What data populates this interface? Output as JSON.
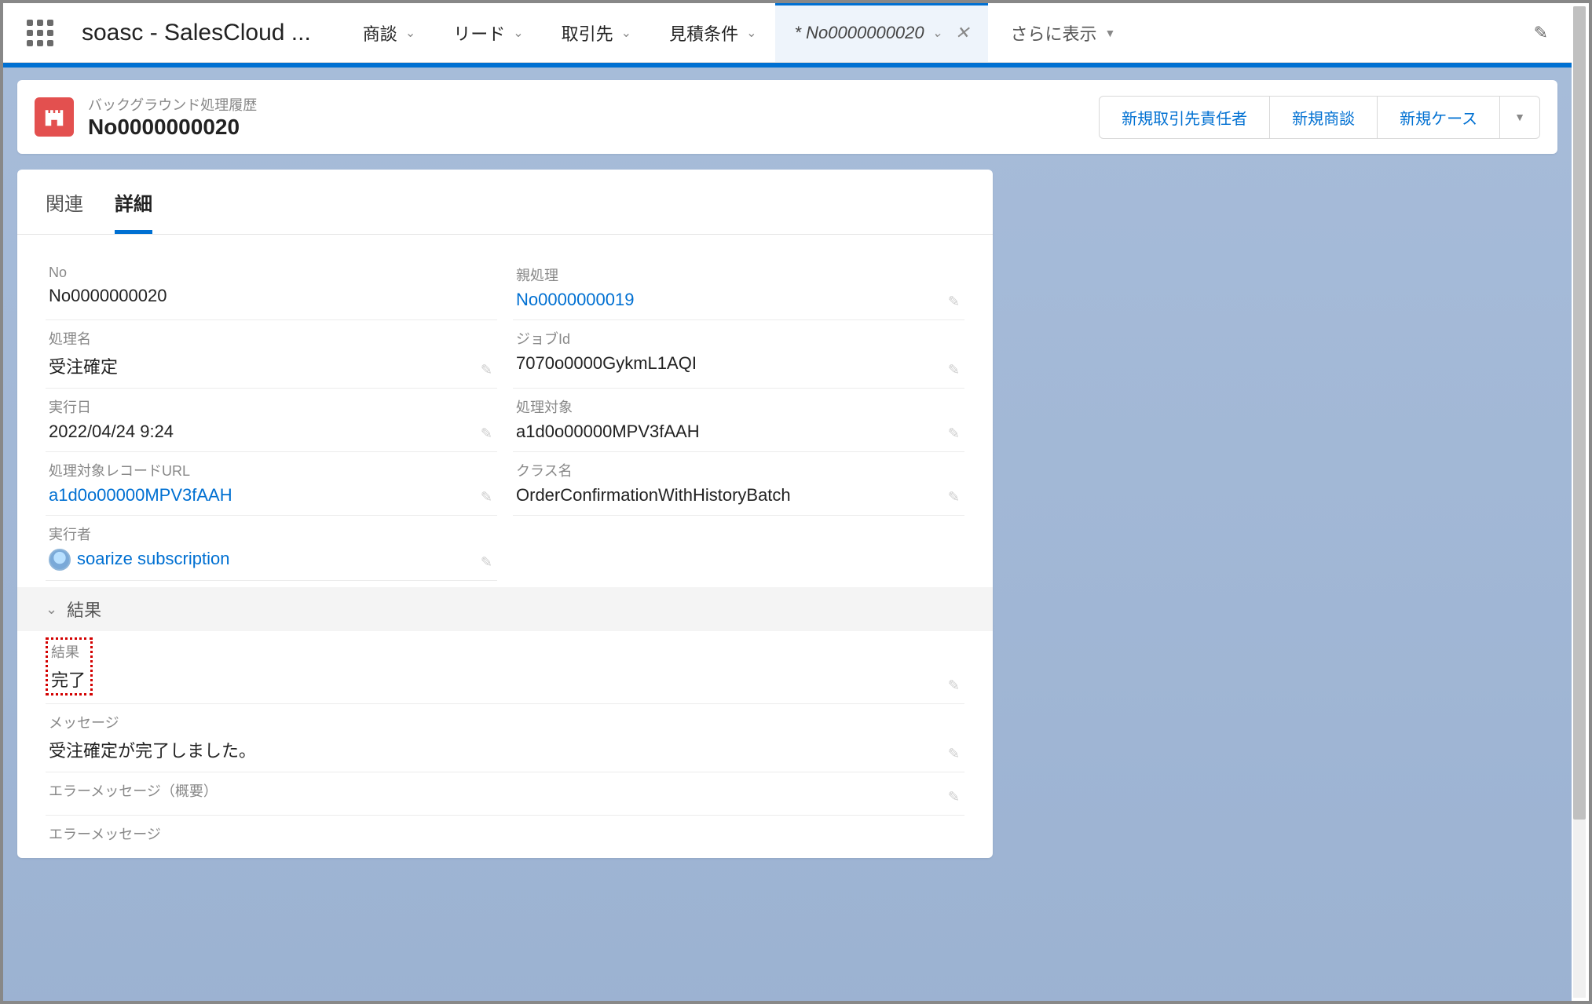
{
  "app": {
    "name": "soasc - SalesCloud ..."
  },
  "nav": {
    "items": [
      {
        "label": "商談"
      },
      {
        "label": "リード"
      },
      {
        "label": "取引先"
      },
      {
        "label": "見積条件"
      }
    ],
    "active_tab": "* No0000000020",
    "more_label": "さらに表示"
  },
  "record": {
    "type_label": "バックグラウンド処理履歴",
    "name": "No0000000020",
    "actions": [
      "新規取引先責任者",
      "新規商談",
      "新規ケース"
    ]
  },
  "tabs": {
    "related": "関連",
    "detail": "詳細"
  },
  "fields": {
    "no": {
      "label": "No",
      "value": "No0000000020"
    },
    "parent": {
      "label": "親処理",
      "value": "No0000000019"
    },
    "process_name": {
      "label": "処理名",
      "value": "受注確定"
    },
    "job_id": {
      "label": "ジョブId",
      "value": "7070o0000GykmL1AQI"
    },
    "exec_date": {
      "label": "実行日",
      "value": "2022/04/24 9:24"
    },
    "target": {
      "label": "処理対象",
      "value": "a1d0o00000MPV3fAAH"
    },
    "record_url": {
      "label": "処理対象レコードURL",
      "value": "a1d0o00000MPV3fAAH"
    },
    "class_name": {
      "label": "クラス名",
      "value": "OrderConfirmationWithHistoryBatch"
    },
    "executor": {
      "label": "実行者",
      "value": "soarize subscription"
    }
  },
  "section_result": "結果",
  "result_fields": {
    "result": {
      "label": "結果",
      "value": "完了"
    },
    "message": {
      "label": "メッセージ",
      "value": "受注確定が完了しました。"
    },
    "error_summary": {
      "label": "エラーメッセージ（概要）",
      "value": ""
    },
    "error_message": {
      "label": "エラーメッセージ",
      "value": ""
    }
  }
}
